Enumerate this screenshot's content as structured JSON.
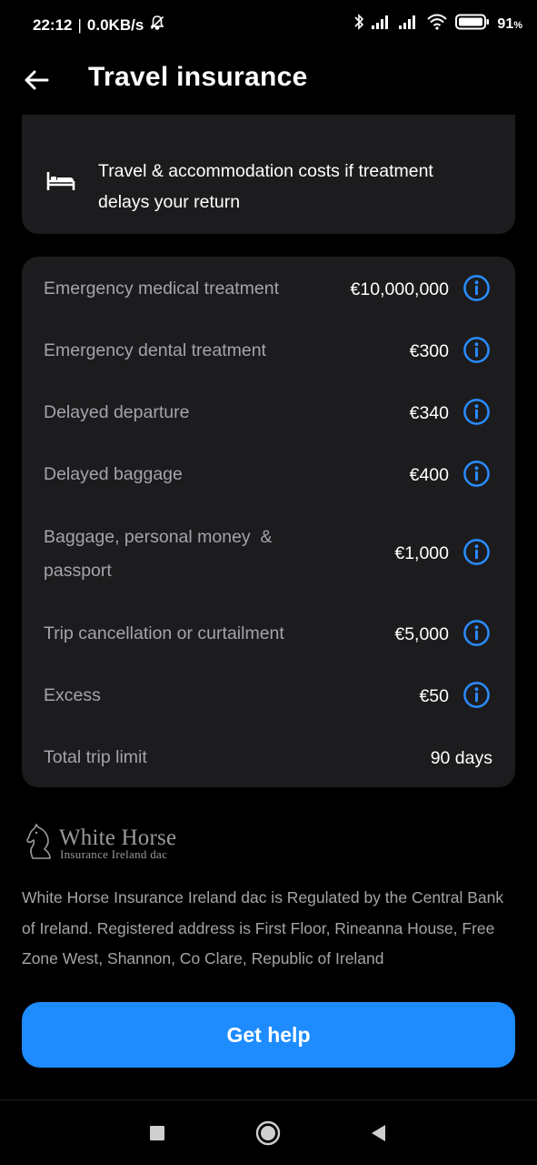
{
  "status_bar": {
    "time": "22:12",
    "speed": "0.0KB/s",
    "battery": "91",
    "battery_unit": "%",
    "icons": [
      "mute-icon",
      "bluetooth-icon",
      "signal-icon",
      "signal-icon-2",
      "wifi-icon",
      "battery-icon"
    ]
  },
  "header": {
    "title": "Travel insurance",
    "back_icon": "arrow-left-icon"
  },
  "accommodation_card": {
    "icon": "bed-icon",
    "text": "Travel & accommodation costs if treatment delays your return"
  },
  "cover": {
    "rows": [
      {
        "label": "Emergency medical treatment",
        "value": "€10,000,000",
        "info": true
      },
      {
        "label": "Emergency dental treatment",
        "value": "€300",
        "info": true
      },
      {
        "label": "Delayed departure",
        "value": "€340",
        "info": true
      },
      {
        "label": "Delayed baggage",
        "value": "€400",
        "info": true
      },
      {
        "label": "Baggage, personal money  &",
        "label2": "passport",
        "value": "€1,000",
        "info": true
      },
      {
        "label": "Trip cancellation or curtailment",
        "value": "€5,000",
        "info": true
      },
      {
        "label": "Excess",
        "value": "€50",
        "info": true
      },
      {
        "label": "Total trip limit",
        "value": "90 days",
        "info": false
      }
    ]
  },
  "insurer": {
    "logo_name": "White Horse",
    "logo_sub": "Insurance Ireland dac",
    "disclaimer": "White Horse Insurance Ireland dac is Regulated by the Central Bank of Ireland. Registered address is First Floor, Rineanna House, Free Zone West, Shannon, Co Clare, Republic of Ireland"
  },
  "actions": {
    "help_label": "Get help"
  },
  "colors": {
    "background": "#000000",
    "card": "#1c1c1e",
    "accent": "#1e8cff",
    "info_icon": "#2a8cff",
    "muted_text": "#a4a4a9"
  },
  "nav": {
    "buttons": [
      "recents-icon",
      "home-icon",
      "back-icon"
    ]
  }
}
